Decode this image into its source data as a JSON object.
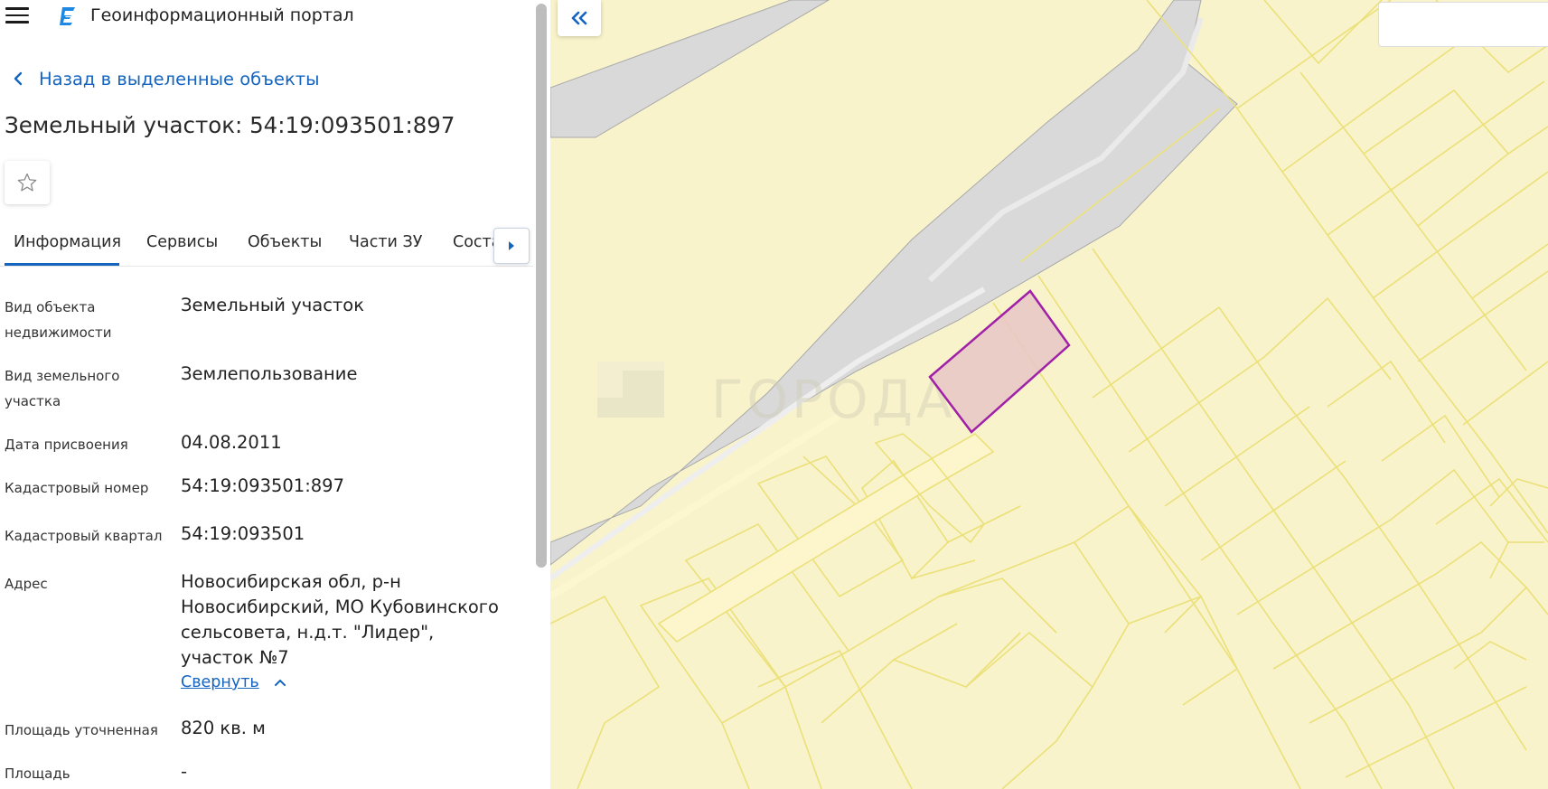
{
  "app": {
    "title": "Геоинформационный портал"
  },
  "nav": {
    "back_label": "Назад в выделенные объекты"
  },
  "object": {
    "title": "Земельный участок: 54:19:093501:897"
  },
  "tabs": [
    {
      "label": "Информация",
      "active": true
    },
    {
      "label": "Сервисы"
    },
    {
      "label": "Объекты"
    },
    {
      "label": "Части ЗУ"
    },
    {
      "label": "Соста"
    }
  ],
  "info": {
    "rows": [
      {
        "label": "Вид объекта недвижимости",
        "value": "Земельный участок"
      },
      {
        "label": "Вид земельного участка",
        "value": "Землепользование"
      },
      {
        "label": "Дата присвоения",
        "value": "04.08.2011"
      },
      {
        "label": "Кадастровый номер",
        "value": "54:19:093501:897"
      },
      {
        "label": "Кадастровый квартал",
        "value": "54:19:093501"
      },
      {
        "label": "Адрес",
        "value": "Новосибирская обл, р-н Новосибирский, МО Кубовинского сельсовета, н.д.т. \"Лидер\", участок №7"
      },
      {
        "label": "Площадь уточненная",
        "value": "820 кв. м"
      },
      {
        "label": "Площадь",
        "value": "-"
      }
    ],
    "collapse_label": "Свернуть"
  },
  "map": {
    "watermark": "ГОРОДА",
    "colors": {
      "background": "#f8f3ca",
      "parcel_line": "#ebe07a",
      "road_fill": "#d9d9d9",
      "selected_fill": "#e9c6c8",
      "selected_stroke": "#a020a8"
    }
  },
  "theme": {
    "accent": "#1565c0"
  }
}
